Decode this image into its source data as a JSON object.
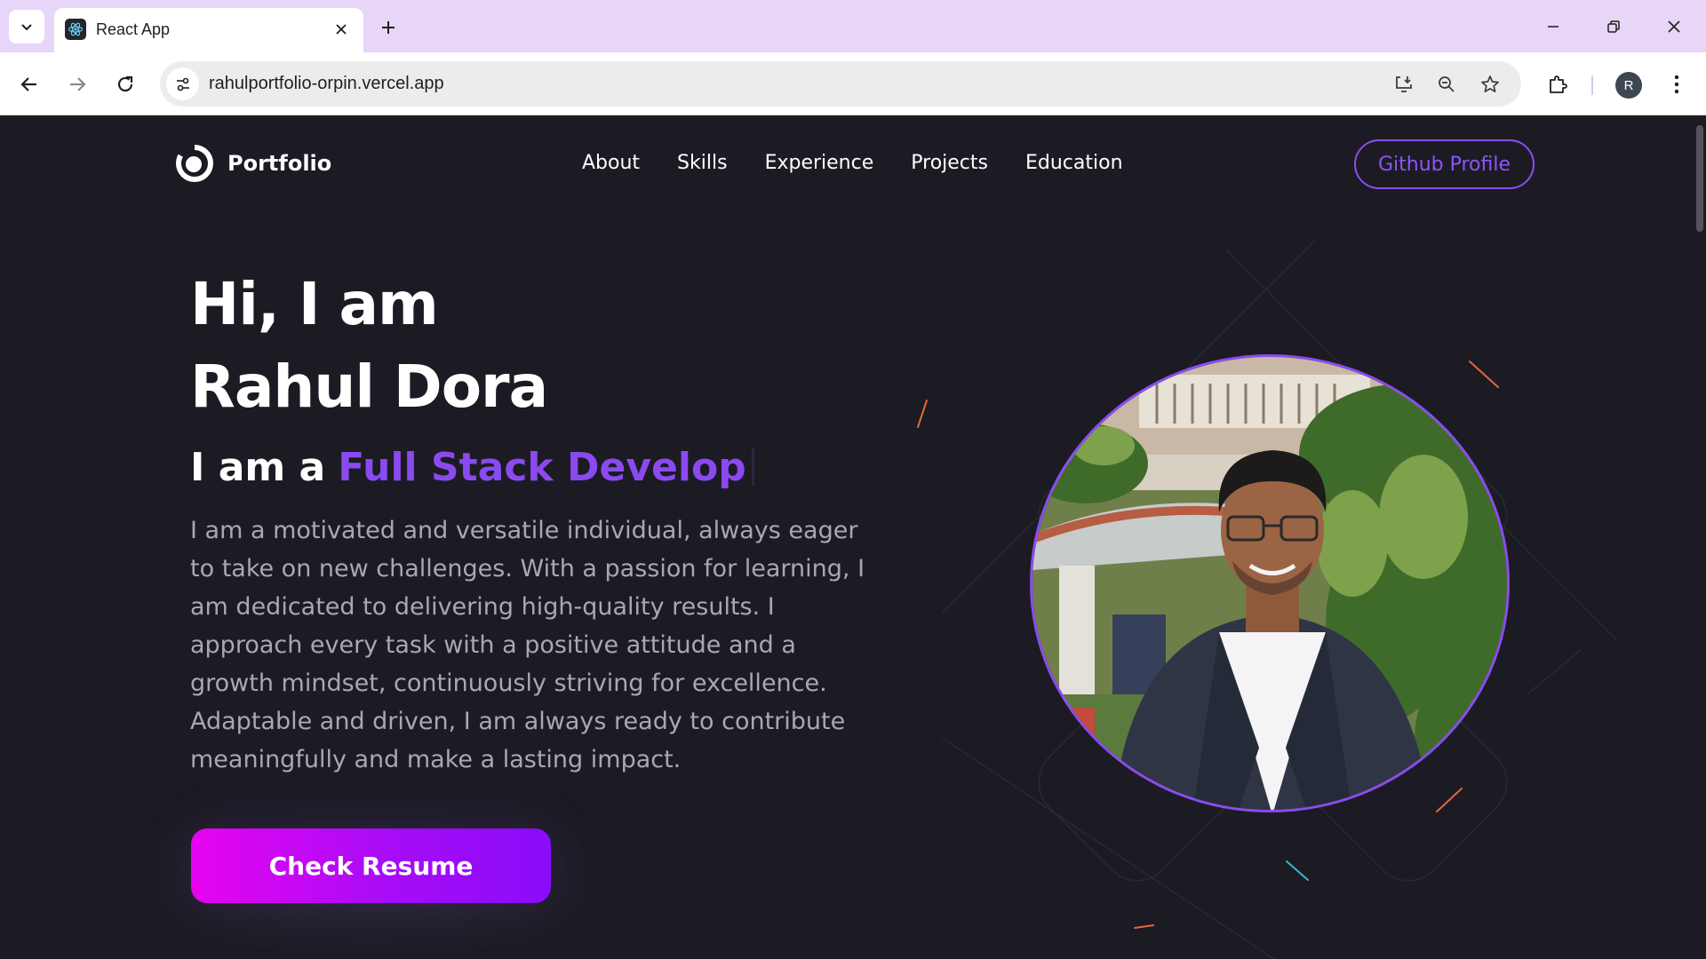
{
  "browser": {
    "tab_title": "React App",
    "url": "rahulportfolio-orpin.vercel.app",
    "profile_initial": "R",
    "icons": [
      "tab-list-chevron-icon",
      "react-favicon-icon",
      "close-icon",
      "plus-icon",
      "minimize-icon",
      "restore-icon",
      "close-window-icon",
      "back-arrow-icon",
      "forward-arrow-icon",
      "reload-icon",
      "site-info-icon",
      "install-app-icon",
      "zoom-icon",
      "bookmark-star-icon",
      "extensions-puzzle-icon",
      "more-vert-icon"
    ]
  },
  "navbar": {
    "logo_text": "Portfolio",
    "links": [
      "About",
      "Skills",
      "Experience",
      "Projects",
      "Education"
    ],
    "github_button": "Github Profile"
  },
  "hero": {
    "greeting": "Hi, I am",
    "name": "Rahul Dora",
    "role_prefix": "I am a",
    "role_typed": "Full Stack Develop",
    "bio": "I am a motivated and versatile individual, always eager to take on new challenges. With a passion for learning, I am dedicated to delivering high-quality results. I approach every task with a positive attitude and a growth mindset, continuously striving for excellence. Adaptable and driven, I am always ready to contribute meaningfully and make a lasting impact.",
    "resume_button": "Check Resume"
  },
  "colors": {
    "page_bg": "#1c1b23",
    "accent_purple": "#8b4af0",
    "button_gradient_start": "#e704ef",
    "button_gradient_end": "#8a0cf8",
    "browser_frame": "#e7d6f7"
  }
}
